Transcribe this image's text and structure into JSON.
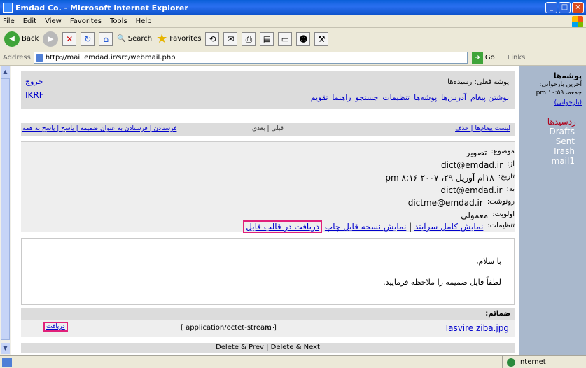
{
  "window": {
    "title": "Emdad Co. - Microsoft Internet Explorer"
  },
  "menu": [
    "File",
    "Edit",
    "View",
    "Favorites",
    "Tools",
    "Help"
  ],
  "toolbar": {
    "back": "Back",
    "search": "Search",
    "favorites": "Favorites"
  },
  "address": {
    "label": "Address",
    "url": "http://mail.emdad.ir/src/webmail.php",
    "go": "Go",
    "links": "Links"
  },
  "folders": {
    "title": "پوشه‌ها",
    "last_check_label": "آخرین بارخوانی:",
    "last_check_value": "جمعه، pm ۱۰:۵۹",
    "refresh": "(بارخوانی)",
    "inbox": "- ردسیدها",
    "items": [
      "Drafts",
      "Sent",
      "Trash",
      "mail1"
    ]
  },
  "topbar": {
    "folder_line": "پوشه فعلی: رسیده‌ها",
    "nav": [
      "نوشتن پیغام",
      "آدرس‌ها",
      "پوشه‌ها",
      "تنظیمات",
      "جستجو",
      "راهنما",
      "تقویم"
    ],
    "logout": "خروج",
    "company": "IKRF"
  },
  "actionbar": {
    "right": "لیست پیغام‌ها | حذف",
    "mid": "قبلی | بعدی",
    "left": "فرستادن | فرستادن به عنوان ضمیمه | پاسخ | پاسخ به همه"
  },
  "headers": {
    "subject_label": "موضوع:",
    "subject_value": "تصویر",
    "from_label": "از:",
    "from_value": "dict@emdad.ir",
    "date_label": "تاریخ:",
    "date_value": "۱۸ام آوریل ۲۹، ۲۰۰۷ pm ۸:۱۶",
    "to_label": "به:",
    "to_value": "dict@emdad.ir",
    "cc_label": "رونوشت:",
    "cc_value": "dictme@emdad.ir",
    "priority_label": "اولویت:",
    "priority_value": "معمولی",
    "options_label": "تنظیمات:",
    "opt_full_header": "نمایش کامل سرآیند",
    "opt_printable": "نمایش نسخه قابل چاپ",
    "opt_download": "دریافت در قالب فایل"
  },
  "body": {
    "line1": "با سلام،",
    "line2": "لطفاً فایل ضمیمه را ملاحظه فرمایید."
  },
  "attachments": {
    "title": "ضمائم:",
    "filename": "Tasvire ziba.jpg",
    "size": "k ۰",
    "mime": "[ application/octet-stream ]",
    "download": "دریافت"
  },
  "footer": {
    "text": "Delete & Prev | Delete & Next"
  },
  "status": {
    "zone": "Internet"
  }
}
